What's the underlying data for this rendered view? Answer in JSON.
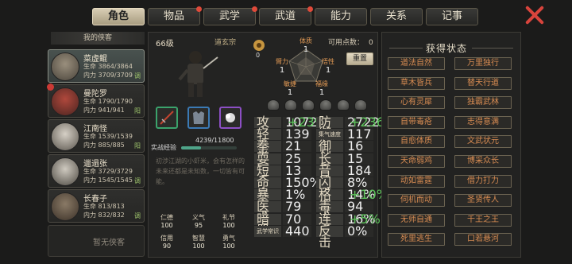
{
  "tabs": [
    {
      "label": "角色",
      "active": true,
      "dot": false
    },
    {
      "label": "物品",
      "active": false,
      "dot": true
    },
    {
      "label": "武学",
      "active": false,
      "dot": true
    },
    {
      "label": "武道",
      "active": false,
      "dot": true
    },
    {
      "label": "能力",
      "active": false,
      "dot": false
    },
    {
      "label": "关系",
      "active": false,
      "dot": false
    },
    {
      "label": "记事",
      "active": false,
      "dot": false
    }
  ],
  "left": {
    "title": "我的侠客",
    "heroes": [
      {
        "name": "菜虚鲲",
        "hp": "生命 3864/3864",
        "mp": "内力 3709/3709",
        "tag": "调",
        "selected": true,
        "badge": false
      },
      {
        "name": "曼陀罗",
        "hp": "生命 1790/1790",
        "mp": "内力 941/941",
        "tag": "阳",
        "selected": false,
        "badge": true
      },
      {
        "name": "江南怪",
        "hp": "生命 1539/1539",
        "mp": "内力 885/885",
        "tag": "阳",
        "selected": false,
        "badge": false
      },
      {
        "name": "邋遢张",
        "hp": "生命 3729/3729",
        "mp": "内力 1545/1545",
        "tag": "调",
        "selected": false,
        "badge": false
      },
      {
        "name": "长春子",
        "hp": "生命 813/813",
        "mp": "内力 832/832",
        "tag": "调",
        "selected": false,
        "badge": false
      }
    ],
    "empty": "暂无侠客"
  },
  "center": {
    "level": "66级",
    "sect": "道玄宗",
    "points_label": "可用点数：",
    "points": "0",
    "token_count": "0",
    "reset": "重置",
    "attrs": {
      "tizhi": {
        "k": "体质",
        "v": "1"
      },
      "biLi": {
        "k": "臂力",
        "v": "1"
      },
      "wuxing": {
        "k": "悟性",
        "v": "1"
      },
      "minjie": {
        "k": "敏捷",
        "v": "1"
      },
      "fuyuan": {
        "k": "福缘",
        "v": "1"
      }
    },
    "exp_label": "实战经验",
    "exp": "4239/11800",
    "exp_frac": 0.359,
    "desc": "初涉江湖的小虾米，会有怎样的未来还都是未知数，一切皆有可能。",
    "virtues": [
      {
        "k": "仁德",
        "v": "100"
      },
      {
        "k": "义气",
        "v": "95"
      },
      {
        "k": "礼节",
        "v": "100"
      },
      {
        "k": "信用",
        "v": "90"
      },
      {
        "k": "智慧",
        "v": "100"
      },
      {
        "k": "勇气",
        "v": "100"
      }
    ],
    "stats_left": [
      {
        "k": "攻击力",
        "v": "1072",
        "b": "+239"
      },
      {
        "k": "轻功",
        "v": "139",
        "b": ""
      },
      {
        "k": "拳掌",
        "v": "21",
        "b": ""
      },
      {
        "k": "耍刀",
        "v": "25",
        "b": ""
      },
      {
        "k": "短兵",
        "v": "13",
        "b": ""
      },
      {
        "k": "命中",
        "v": "150%",
        "b": ""
      },
      {
        "k": "暴击",
        "v": "1%",
        "b": ""
      },
      {
        "k": "医术",
        "v": "79",
        "b": ""
      },
      {
        "k": "暗器",
        "v": "70",
        "b": ""
      },
      {
        "k": "武学常识",
        "v": "440",
        "b": ""
      }
    ],
    "stats_right": [
      {
        "k": "防御力",
        "v": "2722",
        "b": "+236"
      },
      {
        "k": "集气速度",
        "v": "117",
        "b": ""
      },
      {
        "k": "御剑",
        "v": "16",
        "b": ""
      },
      {
        "k": "长兵",
        "v": "15",
        "b": ""
      },
      {
        "k": "音律",
        "v": "184",
        "b": ""
      },
      {
        "k": "闪避",
        "v": "8%",
        "b": ""
      },
      {
        "k": "格挡",
        "v": "14%",
        "b": "+10%"
      },
      {
        "k": "毒术",
        "v": "94",
        "b": ""
      },
      {
        "k": "连击",
        "v": "16%",
        "b": "+5%"
      },
      {
        "k": "反击",
        "v": "0%",
        "b": ""
      }
    ]
  },
  "right": {
    "title": "获得状态",
    "statuses": [
      "道法自然",
      "万里独行",
      "草木皆兵",
      "替天行道",
      "心有灵犀",
      "独霸武林",
      "自带毒疮",
      "志得意满",
      "自愈体质",
      "文武状元",
      "天命弱鸡",
      "博采众长",
      "动如雷霆",
      "借力打力",
      "伺机而动",
      "圣贤传人",
      "无师自通",
      "千王之王",
      "死里逃生",
      "口若悬河"
    ]
  }
}
